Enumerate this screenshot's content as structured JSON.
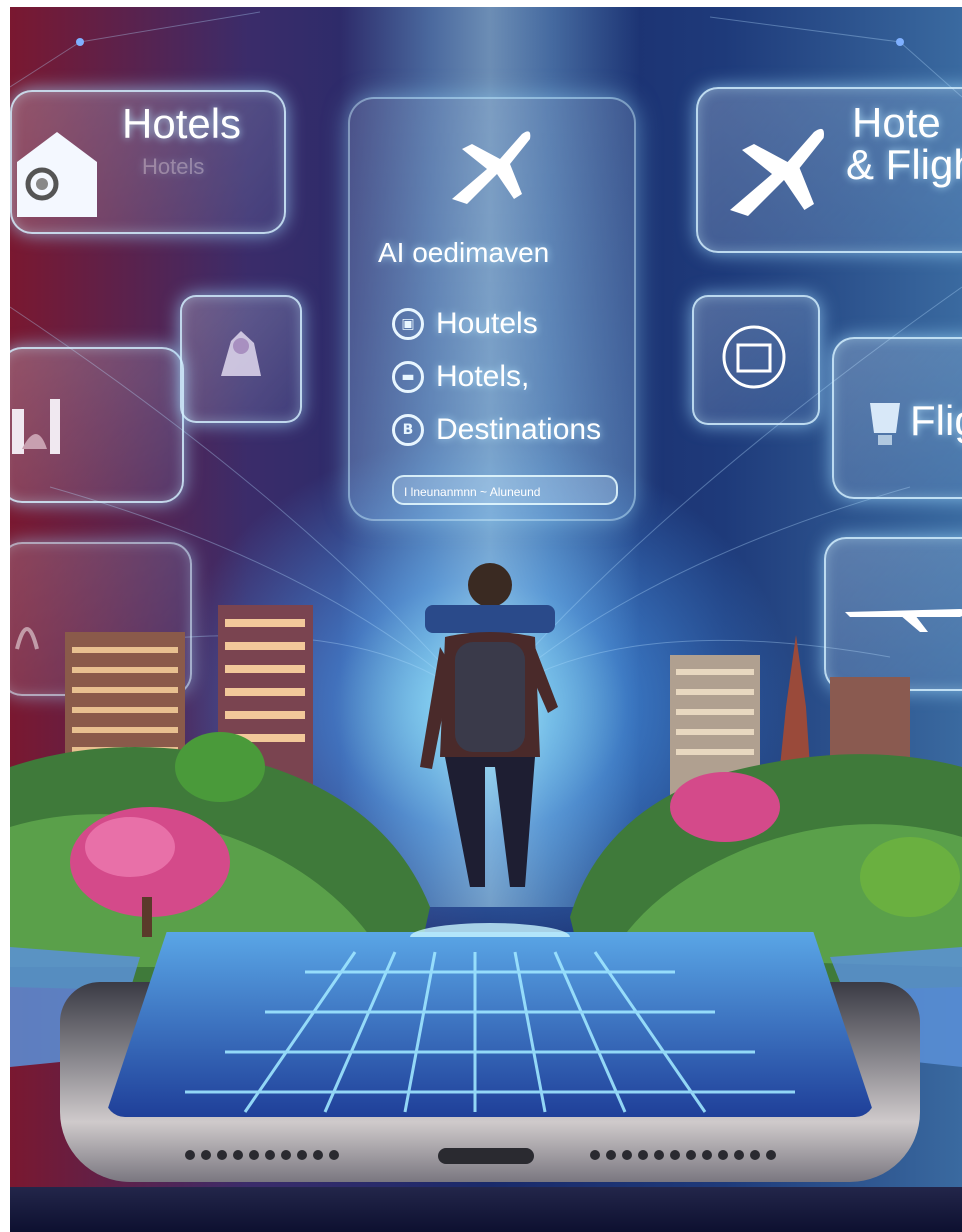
{
  "panels": {
    "top_left": {
      "title": "Hotels",
      "subtitle": "Hotels"
    },
    "top_right": {
      "line1": "Hote",
      "line2": "& Fligh"
    },
    "right_mid": {
      "label": "Flig"
    }
  },
  "center_panel": {
    "app_name": "AI oedimaven",
    "items": [
      {
        "label": "Houtels",
        "icon": "hotel-icon"
      },
      {
        "label": "Hotels,",
        "icon": "bed-icon"
      },
      {
        "label": "Destinations",
        "icon": "map-pin-icon"
      }
    ],
    "search_text": "I lneunanmnn ~ Aluneund"
  },
  "colors": {
    "accent_glow": "#a8e6ff",
    "sky_left": "#7a1830",
    "sky_right": "#3a6aa0"
  }
}
